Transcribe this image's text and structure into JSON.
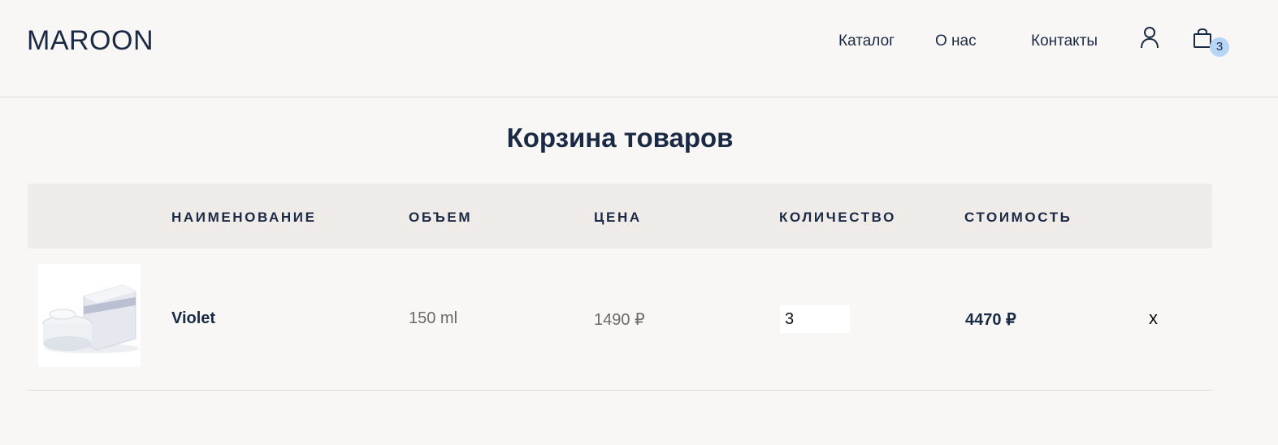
{
  "header": {
    "logo": "MAROON",
    "nav": [
      "Каталог",
      "О нас",
      "Контакты"
    ],
    "cart_count": "3"
  },
  "page": {
    "title": "Корзина товаров"
  },
  "table": {
    "headers": [
      "НАИМЕНОВАНИЕ",
      "ОБЪЕМ",
      "ЦЕНА",
      "КОЛИЧЕСТВО",
      "СТОИМОСТЬ"
    ],
    "rows": [
      {
        "name": "Violet",
        "volume": "150 ml",
        "price": "1490 ₽",
        "quantity": "3",
        "total": "4470 ₽",
        "remove": "x"
      }
    ]
  },
  "colors": {
    "text": "#1b2a44",
    "background": "#f8f7f5",
    "header_band": "#efebe8",
    "badge": "#b7d5f5"
  }
}
